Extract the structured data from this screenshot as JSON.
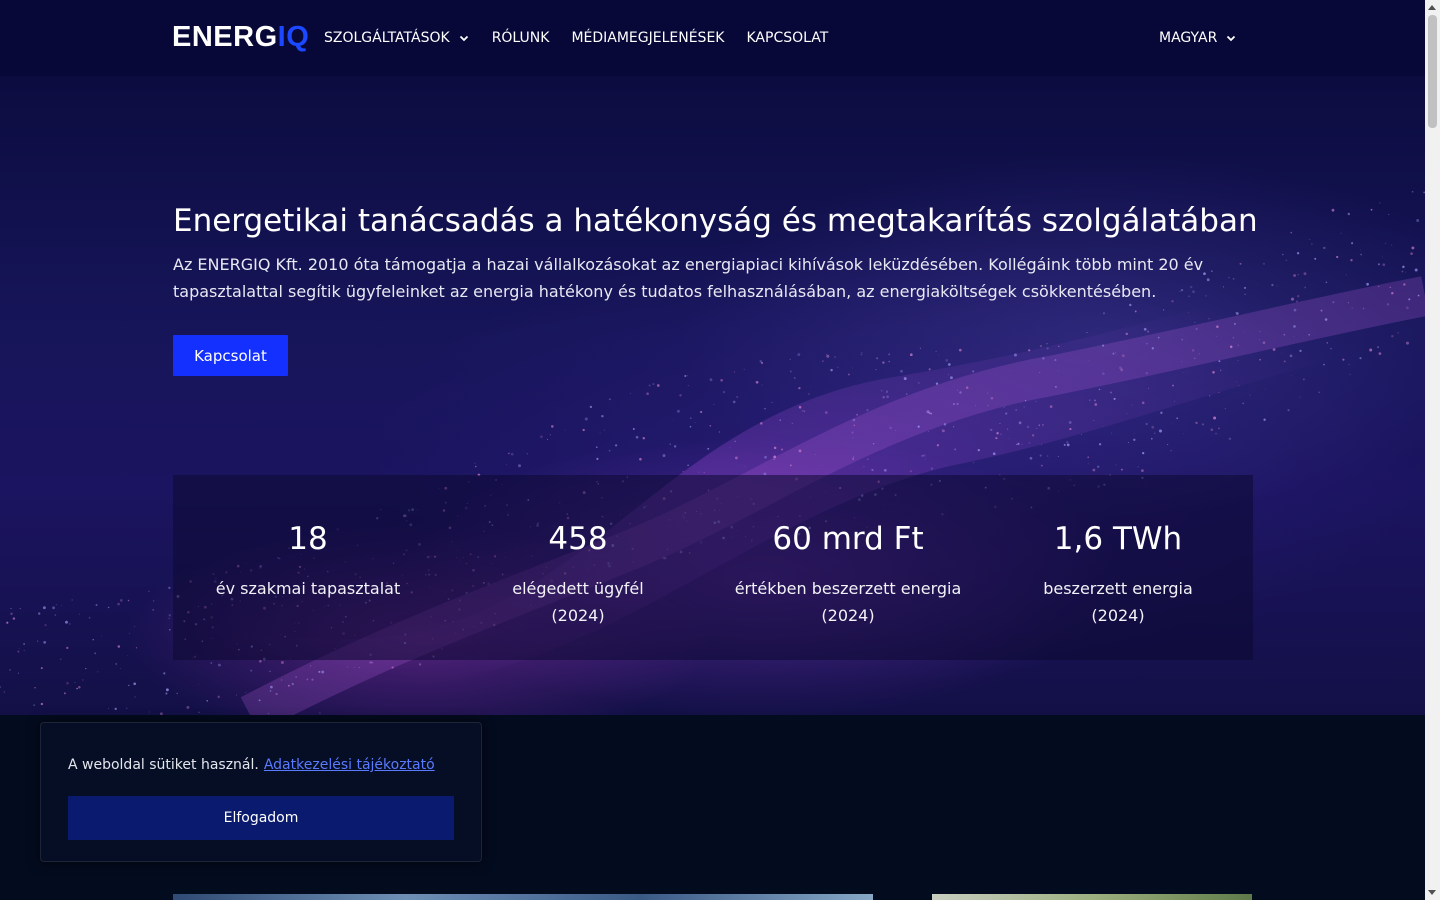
{
  "header": {
    "logo": {
      "part1": "ENERG",
      "part2": "IQ"
    },
    "nav": [
      {
        "label": "SZOLGÁLTATÁSOK",
        "has_dropdown": true
      },
      {
        "label": "RÓLUNK"
      },
      {
        "label": "MÉDIAMEGJELENÉSEK"
      },
      {
        "label": "KAPCSOLAT"
      }
    ],
    "language": "MAGYAR"
  },
  "hero": {
    "title": "Energetikai tanácsadás a hatékonyság és megtakarítás szolgálatában",
    "description": "Az ENERGIQ Kft. 2010 óta támogatja a hazai vállalkozásokat az energiapiaci kihívások leküzdésében. Kollégáink több mint 20 év tapasztalattal segítik ügyfeleinket az energia hatékony és tudatos felhasználásában, az energiaköltségek csökkentésében.",
    "cta": "Kapcsolat"
  },
  "stats": [
    {
      "value": "18",
      "label_line1": "év szakmai tapasztalat",
      "label_line2": ""
    },
    {
      "value": "458",
      "label_line1": "elégedett ügyfél",
      "label_line2": "(2024)"
    },
    {
      "value": "60 mrd Ft",
      "label_line1": "értékben beszerzett energia",
      "label_line2": "(2024)"
    },
    {
      "value": "1,6 TWh",
      "label_line1": "beszerzett energia",
      "label_line2": "(2024)"
    }
  ],
  "cookie": {
    "text": "A weboldal sütiket használ.",
    "link": "Adatkezelési tájékoztató",
    "button": "Elfogadom"
  },
  "colors": {
    "header_bg": "#070838",
    "accent": "#1c49ff",
    "button": "#1330ff",
    "cookie_button": "#0a1a6e",
    "page_bg": "#030b1e"
  }
}
